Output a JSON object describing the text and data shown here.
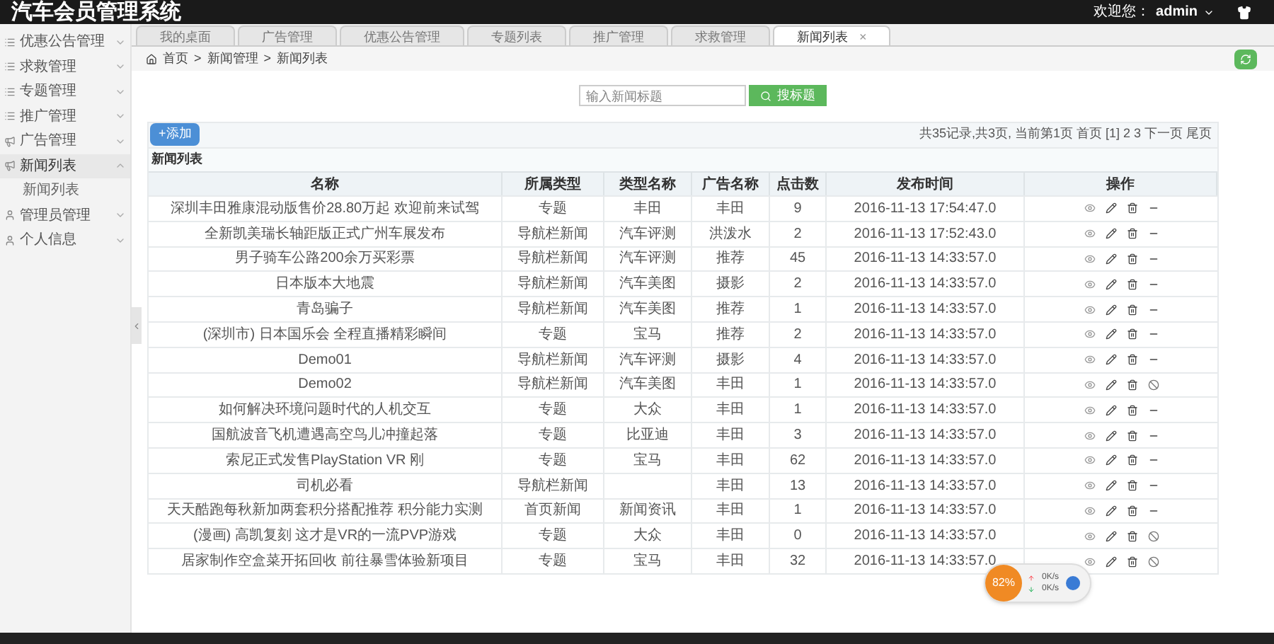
{
  "header": {
    "title": "汽车会员管理系统",
    "welcome": "欢迎您：",
    "user": "admin"
  },
  "sidebar": {
    "items": [
      {
        "label": "优惠公告管理",
        "expanded": false
      },
      {
        "label": "求救管理",
        "expanded": false
      },
      {
        "label": "专题管理",
        "expanded": false
      },
      {
        "label": "推广管理",
        "expanded": false
      },
      {
        "label": "广告管理",
        "expanded": false
      },
      {
        "label": "新闻列表",
        "expanded": true,
        "children": [
          {
            "label": "新闻列表"
          }
        ]
      },
      {
        "label": "管理员管理",
        "expanded": false
      },
      {
        "label": "个人信息",
        "expanded": false
      }
    ]
  },
  "tabs": [
    {
      "label": "我的桌面",
      "selected": false
    },
    {
      "label": "广告管理",
      "selected": false
    },
    {
      "label": "优惠公告管理",
      "selected": false
    },
    {
      "label": "专题列表",
      "selected": false
    },
    {
      "label": "推广管理",
      "selected": false
    },
    {
      "label": "求救管理",
      "selected": false
    },
    {
      "label": "新闻列表",
      "selected": true,
      "close": "×"
    }
  ],
  "breadcrumb": {
    "separator": ">",
    "items": [
      "首页",
      "新闻管理",
      "新闻列表"
    ]
  },
  "search": {
    "placeholder": "输入新闻标题",
    "button": "搜标题"
  },
  "add_button": "+添加",
  "pagination": "共35记录,共3页, 当前第1页 首页 [1] 2 3 下一页 尾页",
  "panel_title": "新闻列表",
  "table": {
    "columns": [
      "名称",
      "所属类型",
      "类型名称",
      "广告名称",
      "点击数",
      "发布时间",
      "操作"
    ],
    "rows": [
      {
        "kind": "minus",
        "cells": [
          "深圳丰田雅康混动版售价28.80万起 欢迎前来试驾",
          "专题",
          "丰田",
          "丰田",
          "9",
          "2016-11-13 17:54:47.0"
        ]
      },
      {
        "kind": "minus",
        "cells": [
          "全新凯美瑞长轴距版正式广州车展发布",
          "导航栏新闻",
          "汽车评测",
          "洪泼水",
          "2",
          "2016-11-13 17:52:43.0"
        ]
      },
      {
        "kind": "minus",
        "cells": [
          "男子骑车公路200余万买彩票",
          "导航栏新闻",
          "汽车评测",
          "推荐",
          "45",
          "2016-11-13 14:33:57.0"
        ]
      },
      {
        "kind": "minus",
        "cells": [
          "日本版本大地震",
          "导航栏新闻",
          "汽车美图",
          "摄影",
          "2",
          "2016-11-13 14:33:57.0"
        ]
      },
      {
        "kind": "minus",
        "cells": [
          "青岛骗子",
          "导航栏新闻",
          "汽车美图",
          "推荐",
          "1",
          "2016-11-13 14:33:57.0"
        ]
      },
      {
        "kind": "minus",
        "cells": [
          "(深圳市) 日本国乐会 全程直播精彩瞬间",
          "专题",
          "宝马",
          "推荐",
          "2",
          "2016-11-13 14:33:57.0"
        ]
      },
      {
        "kind": "minus",
        "cells": [
          "Demo01",
          "导航栏新闻",
          "汽车评测",
          "摄影",
          "4",
          "2016-11-13 14:33:57.0"
        ]
      },
      {
        "kind": "ban",
        "cells": [
          "Demo02",
          "导航栏新闻",
          "汽车美图",
          "丰田",
          "1",
          "2016-11-13 14:33:57.0"
        ]
      },
      {
        "kind": "minus",
        "cells": [
          "如何解决环境问题时代的人机交互",
          "专题",
          "大众",
          "丰田",
          "1",
          "2016-11-13 14:33:57.0"
        ]
      },
      {
        "kind": "minus",
        "cells": [
          "国航波音飞机遭遇高空鸟儿冲撞起落",
          "专题",
          "比亚迪",
          "丰田",
          "3",
          "2016-11-13 14:33:57.0"
        ]
      },
      {
        "kind": "minus",
        "cells": [
          "索尼正式发售PlayStation VR 刚",
          "专题",
          "宝马",
          "丰田",
          "62",
          "2016-11-13 14:33:57.0"
        ]
      },
      {
        "kind": "minus",
        "cells": [
          "司机必看",
          "导航栏新闻",
          null,
          "丰田",
          "13",
          "2016-11-13 14:33:57.0"
        ]
      },
      {
        "kind": "minus",
        "cells": [
          "天天酷跑每秋新加两套积分搭配推荐 积分能力实测",
          "首页新闻",
          "新闻资讯",
          "丰田",
          "1",
          "2016-11-13 14:33:57.0"
        ]
      },
      {
        "kind": "ban",
        "cells": [
          "(漫画) 高凯复刻 这才是VR的一流PVP游戏",
          "专题",
          "大众",
          "丰田",
          "0",
          "2016-11-13 14:33:57.0"
        ]
      },
      {
        "kind": "ban",
        "cells": [
          "居家制作空盒菜开拓回收 前往暴雪体验新项目",
          "专题",
          "宝马",
          "丰田",
          "32",
          "2016-11-13 14:33:57.0"
        ]
      }
    ]
  },
  "speed_widget": {
    "percent": "82%",
    "up": "0K/s",
    "down": "0K/s"
  }
}
